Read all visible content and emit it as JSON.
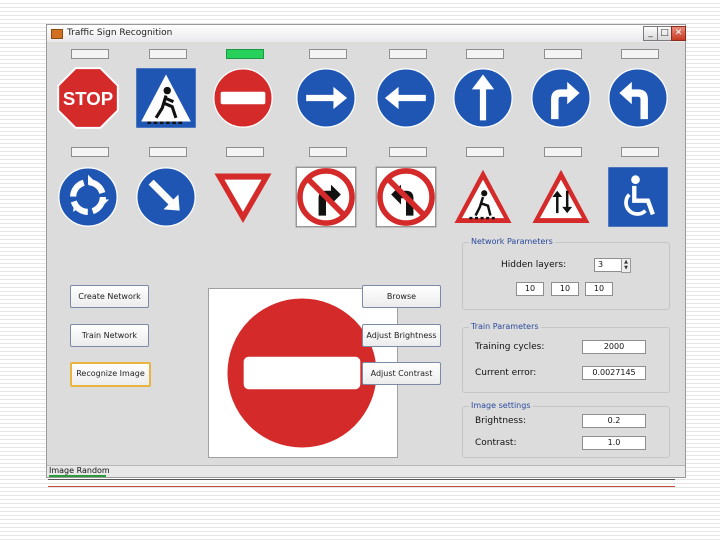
{
  "window": {
    "title": "Traffic Sign Recognition",
    "controls": [
      "_",
      "□",
      "✕"
    ]
  },
  "sign_rows": [
    [
      {
        "name": "stop-sign",
        "active": false
      },
      {
        "name": "pedestrian-crossing-sign",
        "active": false
      },
      {
        "name": "no-entry-sign",
        "active": true
      },
      {
        "name": "arrow-right-sign",
        "active": false
      },
      {
        "name": "arrow-left-sign",
        "active": false
      },
      {
        "name": "arrow-up-sign",
        "active": false
      },
      {
        "name": "turn-right-sign",
        "active": false
      },
      {
        "name": "turn-left-sign",
        "active": false
      }
    ],
    [
      {
        "name": "roundabout-sign",
        "active": false
      },
      {
        "name": "keep-right-sign",
        "active": false
      },
      {
        "name": "yield-sign",
        "active": false
      },
      {
        "name": "no-right-turn-sign",
        "active": false
      },
      {
        "name": "no-left-turn-sign",
        "active": false
      },
      {
        "name": "pedestrian-warning-sign",
        "active": false
      },
      {
        "name": "two-way-traffic-sign",
        "active": false
      },
      {
        "name": "disabled-parking-sign",
        "active": false
      }
    ]
  ],
  "stop_text": "STOP",
  "buttons": {
    "create": "Create Network",
    "train": "Train Network",
    "recognize": "Recognize Image",
    "browse": "Browse",
    "brightness": "Adjust Brightness",
    "contrast": "Adjust Contrast"
  },
  "preview": {
    "sign": "no-entry-sign"
  },
  "network": {
    "title": "Network Parameters",
    "hidden_label": "Hidden layers:",
    "hidden_value": "3",
    "layer_sizes": [
      "10",
      "10",
      "10"
    ]
  },
  "training": {
    "title": "Train Parameters",
    "cycles_label": "Training cycles:",
    "cycles_value": "2000",
    "error_label": "Current error:",
    "error_value": "0.0027145"
  },
  "image": {
    "title": "Image settings",
    "brightness_label": "Brightness:",
    "brightness_value": "0.2",
    "contrast_label": "Contrast:",
    "contrast_value": "1.0"
  },
  "status": {
    "text": "Image Random",
    "progress": 0.09
  },
  "colors": {
    "sign_red": "#d42a2a",
    "sign_blue": "#1f56b4",
    "output_active": "#27d05a",
    "group_title": "#2a4a9c"
  }
}
